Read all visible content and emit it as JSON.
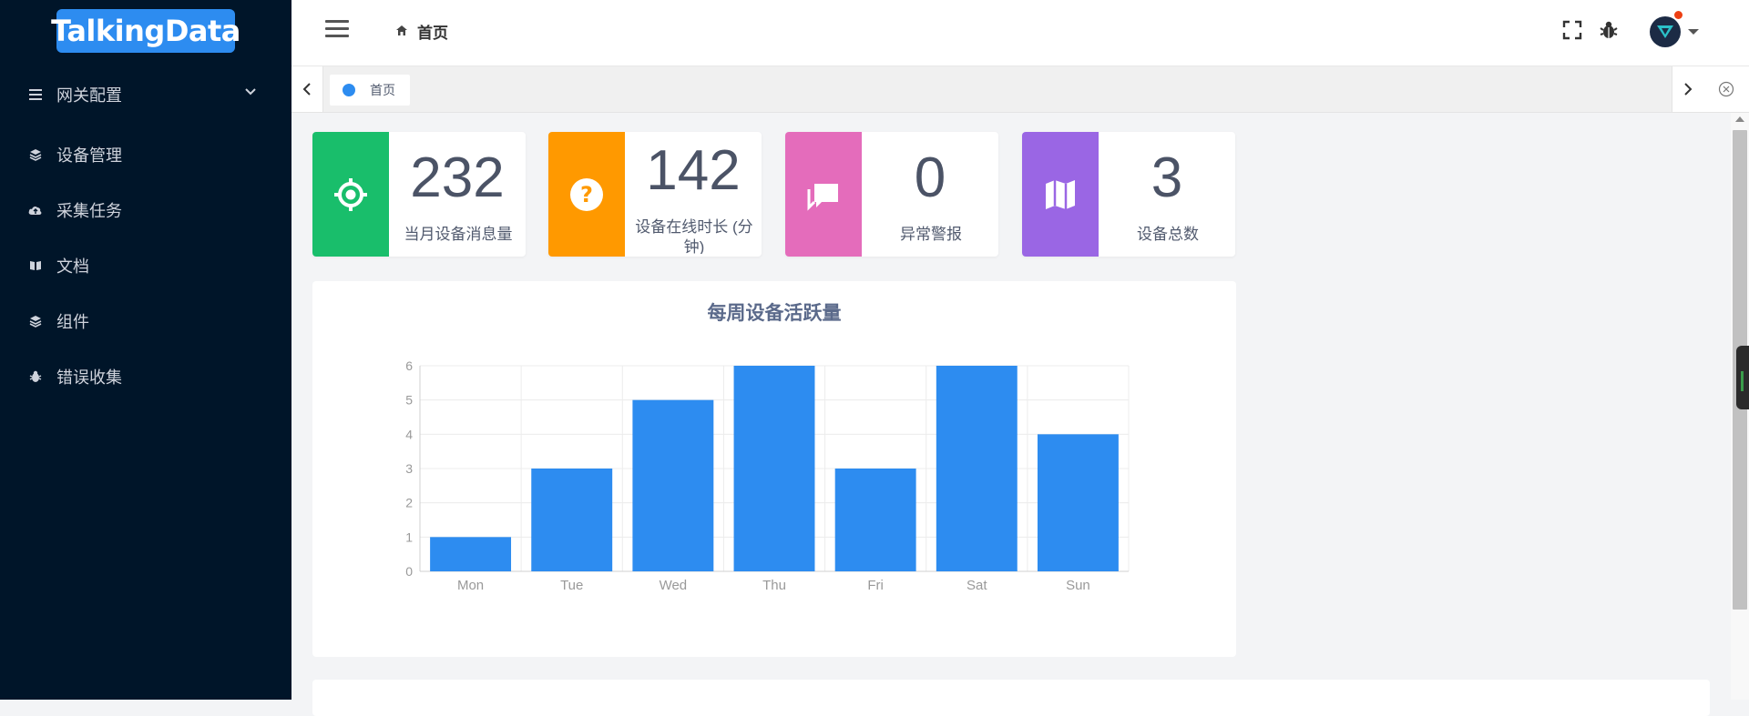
{
  "app": {
    "logo_text": "TalkingData",
    "colors": {
      "sidebar_bg": "#001529",
      "accent": "#2d8cf0"
    }
  },
  "sidebar": {
    "items": [
      {
        "label": "网关配置",
        "icon": "list-icon",
        "has_submenu": true
      },
      {
        "label": "设备管理",
        "icon": "layers-icon"
      },
      {
        "label": "采集任务",
        "icon": "cloud-upload-icon"
      },
      {
        "label": "文档",
        "icon": "book-icon"
      },
      {
        "label": "组件",
        "icon": "layers-icon"
      },
      {
        "label": "错误收集",
        "icon": "bug-icon"
      }
    ]
  },
  "header": {
    "breadcrumb": "首页",
    "icons": [
      "fullscreen-icon",
      "bug-icon",
      "avatar",
      "dropdown-caret-icon"
    ]
  },
  "tabs": [
    {
      "label": "首页",
      "active": true
    }
  ],
  "cards": [
    {
      "value": "232",
      "label": "当月设备消息量",
      "color": "#19be6b",
      "icon": "crosshair-icon"
    },
    {
      "value": "142",
      "label": "设备在线时长 (分钟)",
      "color": "#ff9900",
      "icon": "help-circle-icon"
    },
    {
      "value": "0",
      "label": "异常警报",
      "color": "#e46cbb",
      "icon": "chat-icon"
    },
    {
      "value": "3",
      "label": "设备总数",
      "color": "#9a66e4",
      "icon": "map-icon"
    }
  ],
  "chart_data": {
    "type": "bar",
    "title": "每周设备活跃量",
    "categories": [
      "Mon",
      "Tue",
      "Wed",
      "Thu",
      "Fri",
      "Sat",
      "Sun"
    ],
    "values": [
      1,
      3,
      5,
      6,
      3,
      6,
      4
    ],
    "ylim": [
      0,
      6
    ],
    "yticks": [
      0,
      1,
      2,
      3,
      4,
      5,
      6
    ],
    "xlabel": "",
    "ylabel": "",
    "grid": true,
    "bar_color": "#2d8cf0"
  }
}
